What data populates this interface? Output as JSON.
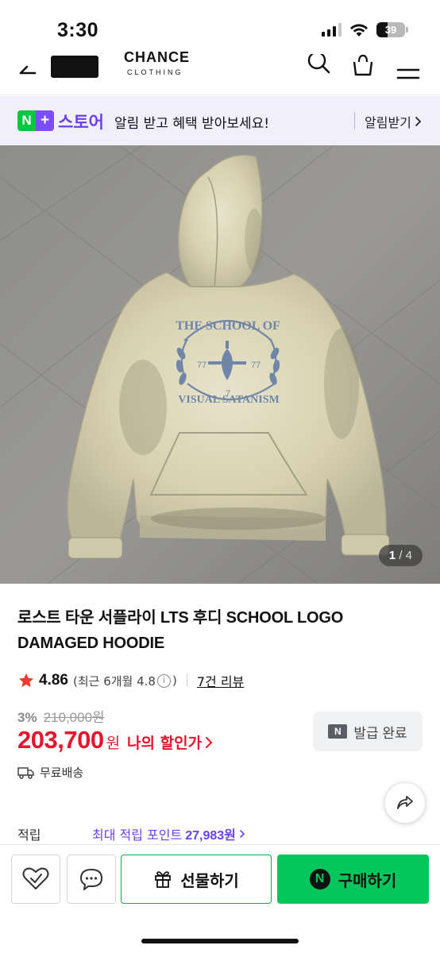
{
  "status_bar": {
    "time": "3:30",
    "battery_level": "39"
  },
  "header": {
    "brand_text": "CHANCE",
    "brand_sub": "CLOTHING"
  },
  "store_banner": {
    "badge_n": "N",
    "badge_plus": "+",
    "store_name": "스토어",
    "message": "알림 받고 혜택 받아보세요!",
    "action_label": "알림받기"
  },
  "gallery": {
    "current": "1",
    "separator": "/",
    "total": "4",
    "print_top": "THE SCHOOL OF",
    "print_bottom": "VISUAL SATANISM",
    "print_left": "77",
    "print_right": "77",
    "print_center": "7"
  },
  "product": {
    "title": "로스트 타운 서플라이 LTS 후디 SCHOOL LOGO DAMAGED HOODIE",
    "rating": "4.86",
    "recent_rating": "(최근 6개월 4.8",
    "recent_rating_close": ")",
    "review_link": "7건 리뷰",
    "discount_rate": "3%",
    "original_price": "210,000원",
    "sale_price": "203,700",
    "price_unit": "원",
    "my_discount_label": "나의 할인가",
    "coupon_badge": "N",
    "coupon_label": "발급 완료",
    "shipping_label": "무료배송",
    "points_label": "적립",
    "points_prefix": "최대 적립 포인트",
    "points_amount": "27,983원"
  },
  "actions": {
    "gift_label": "선물하기",
    "buy_badge": "N",
    "buy_label": "구매하기"
  },
  "colors": {
    "naver_green": "#03c75a",
    "store_purple": "#6a3ff2",
    "price_red": "#e4152d",
    "banner_bg": "#f2effc"
  }
}
